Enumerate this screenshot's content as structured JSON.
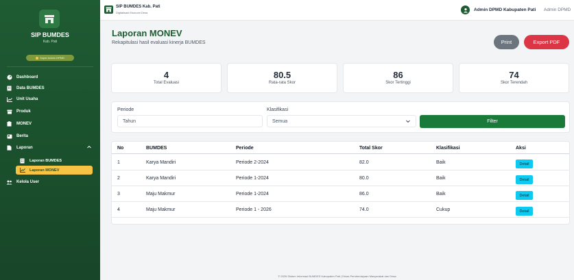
{
  "sidebar": {
    "brand_title": "SIP BUMDES",
    "brand_sub": "Kab. Pati",
    "role_badge": "Super Admin DPMD",
    "items": [
      {
        "label": "Dashboard",
        "icon": "gauge-icon"
      },
      {
        "label": "Data BUMDES",
        "icon": "building-icon"
      },
      {
        "label": "Unit Usaha",
        "icon": "chart-line-icon"
      },
      {
        "label": "Produk",
        "icon": "box-icon"
      },
      {
        "label": "MONEV",
        "icon": "clipboard-icon"
      },
      {
        "label": "Berita",
        "icon": "newspaper-icon"
      },
      {
        "label": "Laporan",
        "icon": "file-icon"
      },
      {
        "label": "Kelola User",
        "icon": "users-icon"
      }
    ],
    "sub_items": [
      {
        "label": "Laporan BUMDES",
        "icon": "building-icon",
        "active": false
      },
      {
        "label": "Laporan MONEV",
        "icon": "chart-line-icon",
        "active": true
      }
    ]
  },
  "topbar": {
    "title": "SIP BUMDES Kab. Pati",
    "subtitle": "Digitalisasi Ekonomi Desa",
    "user_name": "Admin DPMD Kabupaten Pati",
    "user_role": "Admin DPMD"
  },
  "page": {
    "title": "Laporan MONEV",
    "subtitle": "Rekapitulasi hasil evaluasi kinerja BUMDES",
    "print_label": "Print",
    "export_label": "Export PDF"
  },
  "stats": [
    {
      "value": "4",
      "label": "Total Evaluasi"
    },
    {
      "value": "80.5",
      "label": "Rata-rata Skor"
    },
    {
      "value": "86",
      "label": "Skor Tertinggi"
    },
    {
      "value": "74",
      "label": "Skor Terendah"
    }
  ],
  "filter": {
    "periode_label": "Periode",
    "periode_placeholder": "Tahun",
    "klasifikasi_label": "Klasifikasi",
    "klasifikasi_value": "Semua",
    "filter_label": "Filter"
  },
  "table": {
    "headers": [
      "No",
      "BUMDES",
      "Periode",
      "Total Skor",
      "Klasifikasi",
      "Aksi"
    ],
    "rows": [
      {
        "no": "1",
        "bumdes": "Karya Mandiri",
        "periode": "Periode 2-2024",
        "skor": "82.0",
        "klasifikasi": "Baik",
        "aksi": "Detail"
      },
      {
        "no": "2",
        "bumdes": "Karya Mandiri",
        "periode": "Periode 1-2024",
        "skor": "80.0",
        "klasifikasi": "Baik",
        "aksi": "Detail"
      },
      {
        "no": "3",
        "bumdes": "Maju Makmur",
        "periode": "Periode 1-2024",
        "skor": "86.0",
        "klasifikasi": "Baik",
        "aksi": "Detail"
      },
      {
        "no": "4",
        "bumdes": "Maju Makmur",
        "periode": "Periode 1 - 2026",
        "skor": "74.0",
        "klasifikasi": "Cukup",
        "aksi": "Detail"
      }
    ]
  },
  "footer": {
    "text": "© 2026 Sistem Informasi BUMDES Kabupaten Pati | Dinas Pemberdayaan Masyarakat dan Desa"
  },
  "colors": {
    "sidebar": "#1f5b33",
    "accent": "#f6c344",
    "primary_green": "#1a7a3a",
    "danger": "#dc3545",
    "info": "#0dcaf0"
  }
}
